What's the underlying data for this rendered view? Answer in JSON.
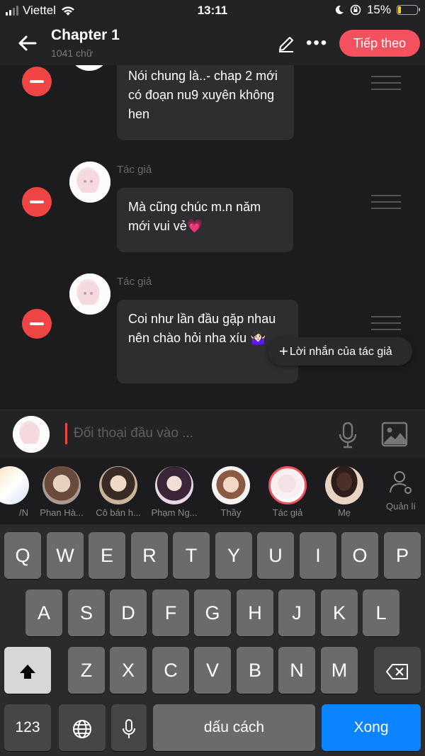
{
  "status_bar": {
    "carrier": "Viettel",
    "time": "13:11",
    "battery": "15%"
  },
  "header": {
    "title": "Chapter 1",
    "word_count": "1041 chữ",
    "next_label": "Tiếp theo"
  },
  "messages": [
    {
      "author": "",
      "text": "Nói chung là..- chap 2 mới có đoạn nu9 xuyên không hen"
    },
    {
      "author": "Tác giả",
      "text": "Mà cũng chúc m.n năm mới vui vẻ💗"
    },
    {
      "author": "Tác giả",
      "text": "Coi như lần đầu gặp nhau nên chào hỏi nha xíu 🤷🏻‍♀️"
    }
  ],
  "tooltip": {
    "label": "Lời nhắn của tác giả"
  },
  "input": {
    "placeholder": "Đối thoại đầu vào ..."
  },
  "characters": [
    {
      "name": "/N"
    },
    {
      "name": "Phan Hà..."
    },
    {
      "name": "Cô bán h..."
    },
    {
      "name": "Phạm Ng..."
    },
    {
      "name": "Thầy"
    },
    {
      "name": "Tác giả",
      "selected": true
    },
    {
      "name": "Mẹ"
    }
  ],
  "manage_label": "Quản lí",
  "keyboard": {
    "row1": [
      "Q",
      "W",
      "E",
      "R",
      "T",
      "Y",
      "U",
      "I",
      "O",
      "P"
    ],
    "row2": [
      "A",
      "S",
      "D",
      "F",
      "G",
      "H",
      "J",
      "K",
      "L"
    ],
    "row3": [
      "Z",
      "X",
      "C",
      "V",
      "B",
      "N",
      "M"
    ],
    "numbers": "123",
    "space": "dấu cách",
    "done": "Xong"
  },
  "colors": {
    "accent": "#f3515d",
    "remove": "#ef4545",
    "done": "#0a84ff",
    "battery": "#f7d21c"
  },
  "icons": [
    "back-arrow-icon",
    "edit-icon",
    "more-icon",
    "remove-icon",
    "drag-handle-icon",
    "plus-icon",
    "mic-icon",
    "image-icon",
    "manage-user-icon",
    "shift-icon",
    "backspace-icon",
    "globe-icon"
  ]
}
